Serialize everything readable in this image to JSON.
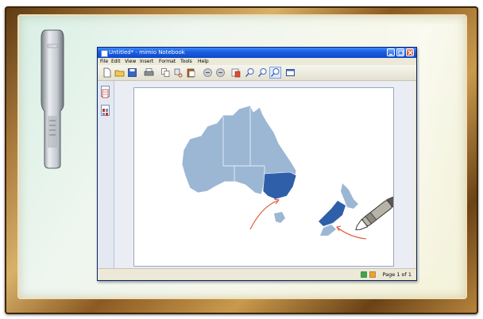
{
  "window": {
    "title": "Untitled* - mimio Notebook"
  },
  "menu": [
    {
      "label": "File"
    },
    {
      "label": "Edit"
    },
    {
      "label": "View"
    },
    {
      "label": "Insert"
    },
    {
      "label": "Format"
    },
    {
      "label": "Tools"
    },
    {
      "label": "Help"
    }
  ],
  "toolbar": {
    "tools": [
      "new-document-icon",
      "open-folder-icon",
      "save-disk-icon",
      "print-icon",
      "copy-icon",
      "cut-icon",
      "paste-icon",
      "undo-icon",
      "redo-icon",
      "new-page-icon",
      "zoom-in-icon",
      "zoom-out-icon",
      "zoom-fit-icon",
      "screen-icon"
    ]
  },
  "status": {
    "page_label": "Page 1 of 1"
  },
  "colors": {
    "map_light": "#9cb7d4",
    "map_highlight": "#2e5fa8",
    "arrow": "#e0532f",
    "title_bar": "#0d49c8"
  }
}
